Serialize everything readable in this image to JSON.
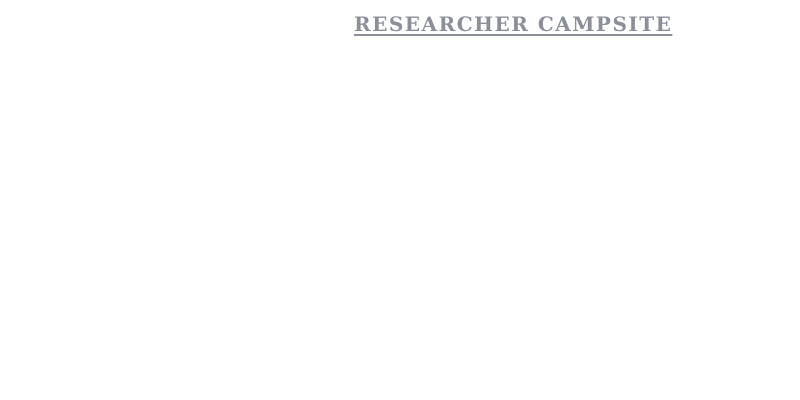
{
  "header": {
    "title": "RESEARCHER CAMPSITE"
  },
  "colors": {
    "title": "#8a8f99",
    "background": "#ffffff"
  }
}
